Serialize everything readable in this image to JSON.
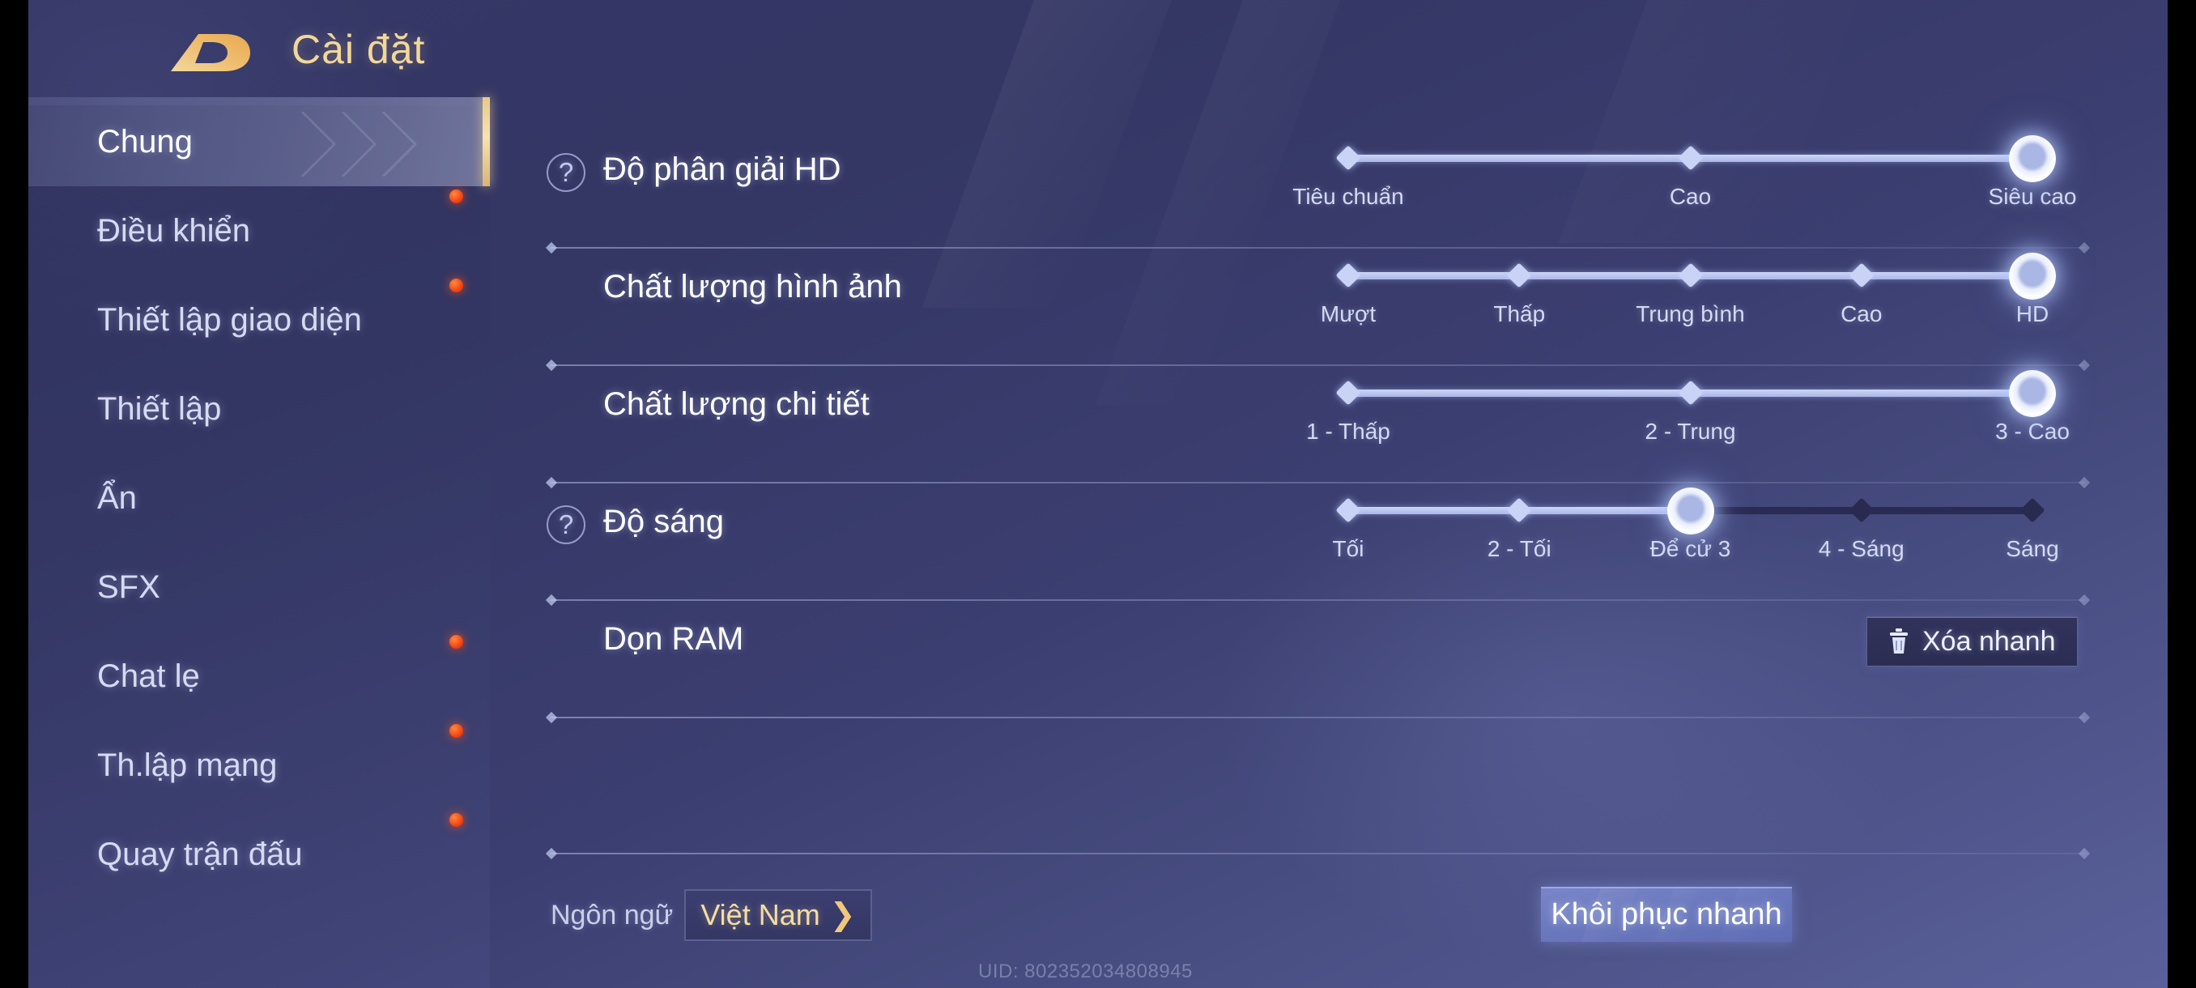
{
  "header": {
    "title": "Cài đặt",
    "logo_icon": "game-logo-icon"
  },
  "sidebar": {
    "items": [
      {
        "label": "Chung",
        "active": true,
        "badge": false
      },
      {
        "label": "Điều khiển",
        "active": false,
        "badge": true
      },
      {
        "label": "Thiết lập giao diện",
        "active": false,
        "badge": true
      },
      {
        "label": "Thiết lập",
        "active": false,
        "badge": false
      },
      {
        "label": "Ẩn",
        "active": false,
        "badge": false
      },
      {
        "label": "SFX",
        "active": false,
        "badge": false
      },
      {
        "label": "Chat lẹ",
        "active": false,
        "badge": true
      },
      {
        "label": "Th.lập mạng",
        "active": false,
        "badge": true
      },
      {
        "label": "Quay trận đấu",
        "active": false,
        "badge": true
      }
    ]
  },
  "settings": {
    "rows": [
      {
        "label": "Độ phân giải HD",
        "has_help": true,
        "control": "slider",
        "ticks": [
          "Tiêu chuẩn",
          "Cao",
          "Siêu cao"
        ],
        "value_index": 2
      },
      {
        "label": "Chất lượng hình ảnh",
        "has_help": false,
        "control": "slider",
        "ticks": [
          "Mượt",
          "Thấp",
          "Trung bình",
          "Cao",
          "HD"
        ],
        "value_index": 4
      },
      {
        "label": "Chất lượng chi tiết",
        "has_help": false,
        "control": "slider",
        "ticks": [
          "1 - Thấp",
          "2 - Trung",
          "3 - Cao"
        ],
        "value_index": 2
      },
      {
        "label": "Độ sáng",
        "has_help": true,
        "control": "slider",
        "ticks": [
          "Tối",
          "2 - Tối",
          "Để cử 3",
          "4 - Sáng",
          "Sáng"
        ],
        "value_index": 2
      },
      {
        "label": "Dọn RAM",
        "has_help": false,
        "control": "button",
        "button_label": "Xóa nhanh",
        "button_icon": "trash-icon"
      }
    ]
  },
  "footer": {
    "language_label": "Ngôn ngữ",
    "language_value": "Việt Nam",
    "language_arrow_icon": "chevron-right-icon",
    "restore_label": "Khôi phục nhanh",
    "uid": "UID: 802352034808945"
  },
  "colors": {
    "accent_gold": "#f3d79a",
    "panel_bg": "#353766",
    "slider_fill": "#c3cdf2",
    "slider_empty": "#2a2b52",
    "badge_red": "#f03a10",
    "restore_blue": "#6b78bd"
  }
}
